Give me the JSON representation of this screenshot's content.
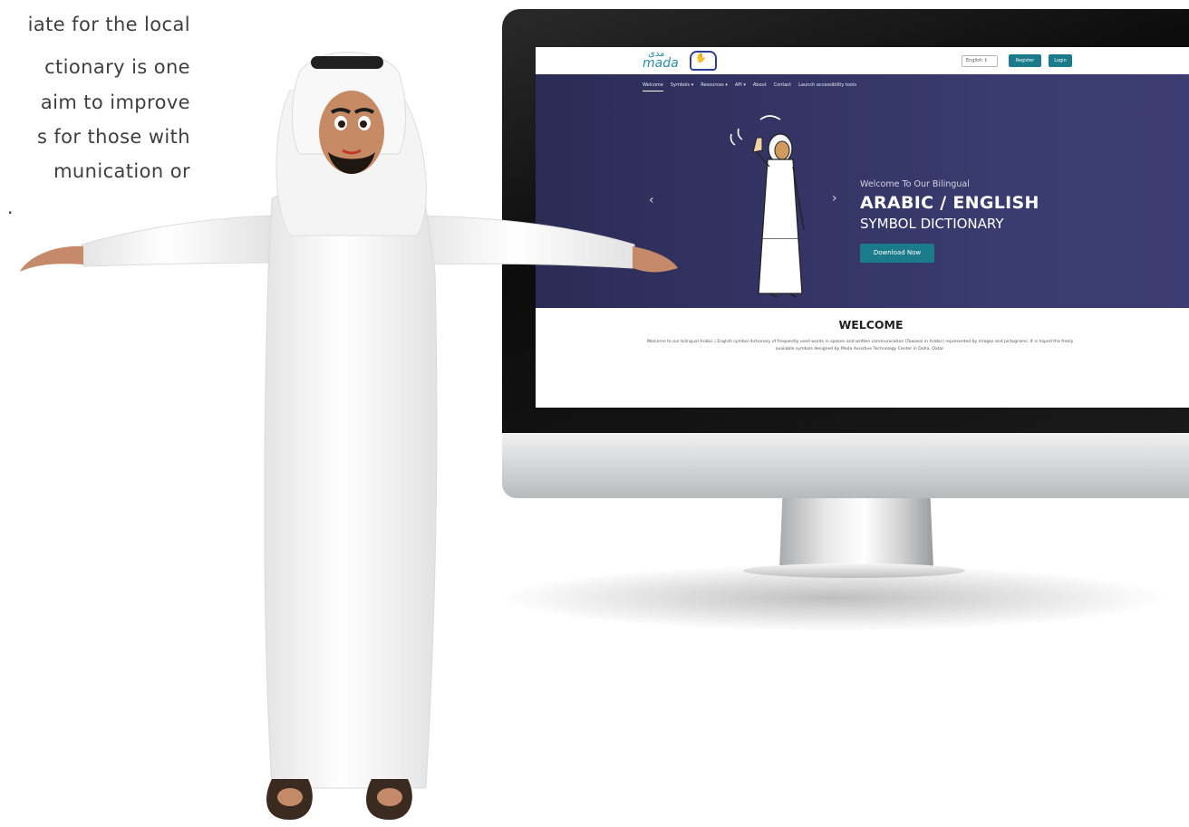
{
  "intro_text": {
    "lines": [
      "iate for the local",
      "ctionary is one",
      "aim to improve",
      "s for those with",
      "munication or",
      "."
    ]
  },
  "site": {
    "logo_mada": "mada",
    "logo_mada_arabic": "مدى",
    "language_select": "English ⇕",
    "register_label": "Register",
    "login_label": "Login",
    "nav": [
      "Welcome",
      "Symbols ▾",
      "Resources ▾",
      "API ▾",
      "About",
      "Contact",
      "Launch accessibility tools"
    ],
    "hero": {
      "subtitle": "Welcome To Our Bilingual",
      "title_line1": "ARABIC / ENGLISH",
      "title_line2": "SYMBOL DICTIONARY",
      "download_label": "Download Now",
      "prev_glyph": "‹",
      "next_glyph": "›"
    },
    "welcome": {
      "title": "WELCOME",
      "body": "Welcome to our bilingual Arabic / English symbol dictionary of frequently used words in spoken and written communication (Tawasol in Arabic) represented by images and pictograms. It is hoped the freely available symbols designed by Mada Assistive Technology Center in Doha, Qatar."
    }
  },
  "colors": {
    "hero_bg": "#343566",
    "accent_teal": "#1b7b8a",
    "monitor_bezel": "#111111"
  }
}
